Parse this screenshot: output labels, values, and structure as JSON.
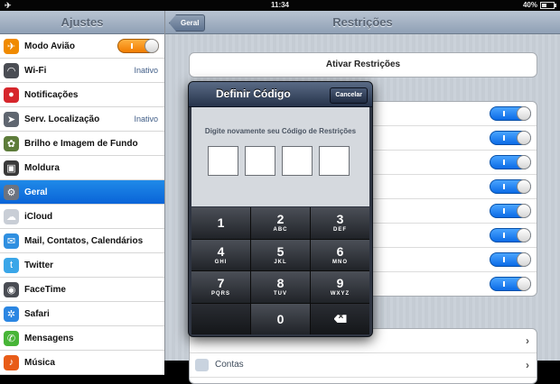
{
  "status": {
    "time": "11:34",
    "battery": "40%"
  },
  "sidebar": {
    "title": "Ajustes",
    "items": [
      {
        "label": "Modo Avião",
        "icon": "airplane-icon",
        "color": "#f08a00",
        "toggle": true
      },
      {
        "label": "Wi-Fi",
        "icon": "wifi-icon",
        "color": "#4a4d54",
        "value": "Inativo"
      },
      {
        "label": "Notificações",
        "icon": "notifications-icon",
        "color": "#d6262c"
      },
      {
        "label": "Serv. Localização",
        "icon": "location-icon",
        "color": "#5f6670",
        "value": "Inativo"
      },
      {
        "label": "Brilho e Imagem de Fundo",
        "icon": "brightness-icon",
        "color": "#5d7c3a"
      },
      {
        "label": "Moldura",
        "icon": "frame-icon",
        "color": "#3a3a3a"
      },
      {
        "label": "Geral",
        "icon": "gear-icon",
        "color": "#6c7380",
        "selected": true
      },
      {
        "label": "iCloud",
        "icon": "cloud-icon",
        "color": "#c9ced6"
      },
      {
        "label": "Mail, Contatos, Calendários",
        "icon": "mail-icon",
        "color": "#2f8fe0"
      },
      {
        "label": "Twitter",
        "icon": "twitter-icon",
        "color": "#3aa6e8"
      },
      {
        "label": "FaceTime",
        "icon": "facetime-icon",
        "color": "#4a4d54"
      },
      {
        "label": "Safari",
        "icon": "safari-icon",
        "color": "#2b86e2"
      },
      {
        "label": "Mensagens",
        "icon": "messages-icon",
        "color": "#47b537"
      },
      {
        "label": "Música",
        "icon": "music-icon",
        "color": "#e85c18"
      }
    ]
  },
  "detail": {
    "back_label": "Geral",
    "title": "Restrições",
    "activate_label": "Ativar Restrições",
    "toggle_rows": 8,
    "lower_rows": [
      {
        "label": ""
      },
      {
        "label": "Contas"
      }
    ]
  },
  "modal": {
    "title": "Definir Código",
    "cancel_label": "Cancelar",
    "prompt": "Digite novamente seu Código de Restrições",
    "keys": [
      {
        "num": "1",
        "letters": ""
      },
      {
        "num": "2",
        "letters": "ABC"
      },
      {
        "num": "3",
        "letters": "DEF"
      },
      {
        "num": "4",
        "letters": "GHI"
      },
      {
        "num": "5",
        "letters": "JKL"
      },
      {
        "num": "6",
        "letters": "MNO"
      },
      {
        "num": "7",
        "letters": "PQRS"
      },
      {
        "num": "8",
        "letters": "TUV"
      },
      {
        "num": "9",
        "letters": "WXYZ"
      },
      {
        "num": "",
        "letters": ""
      },
      {
        "num": "0",
        "letters": ""
      },
      {
        "num": "",
        "letters": "",
        "delete": true
      }
    ]
  }
}
